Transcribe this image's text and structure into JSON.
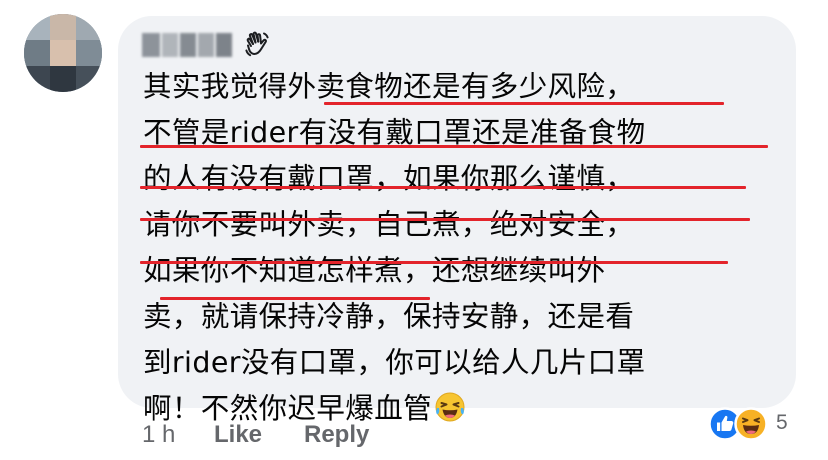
{
  "comment": {
    "lines": [
      "其实我觉得外卖食物还是有多少风险，",
      "不管是rider有没有戴口罩还是准备食物",
      "的人有没有戴口罩，如果你那么谨慎，",
      "请你不要叫外卖，自己煮，绝对安全，",
      "如果你不知道怎样煮，还想继续叫外",
      "卖，就请保持冷静，保持安静，还是看",
      "到rider没有口罩，你可以给人几片口罩",
      "啊！不然你迟早爆血管"
    ],
    "underline_color": "#e3242b",
    "name_badge_icon": "waving-hand-icon",
    "inline_emoji": "laughing-tears-emoji"
  },
  "reactions": {
    "icons": [
      "like-reaction-icon",
      "haha-reaction-icon"
    ],
    "count": "5",
    "like_color": "#1877f2",
    "haha_color": "#f7b125"
  },
  "actions": {
    "timestamp": "1 h",
    "like_label": "Like",
    "reply_label": "Reply"
  },
  "colors": {
    "bubble": "#f0f2f5",
    "text": "#050505",
    "secondary_text": "#65676b"
  }
}
